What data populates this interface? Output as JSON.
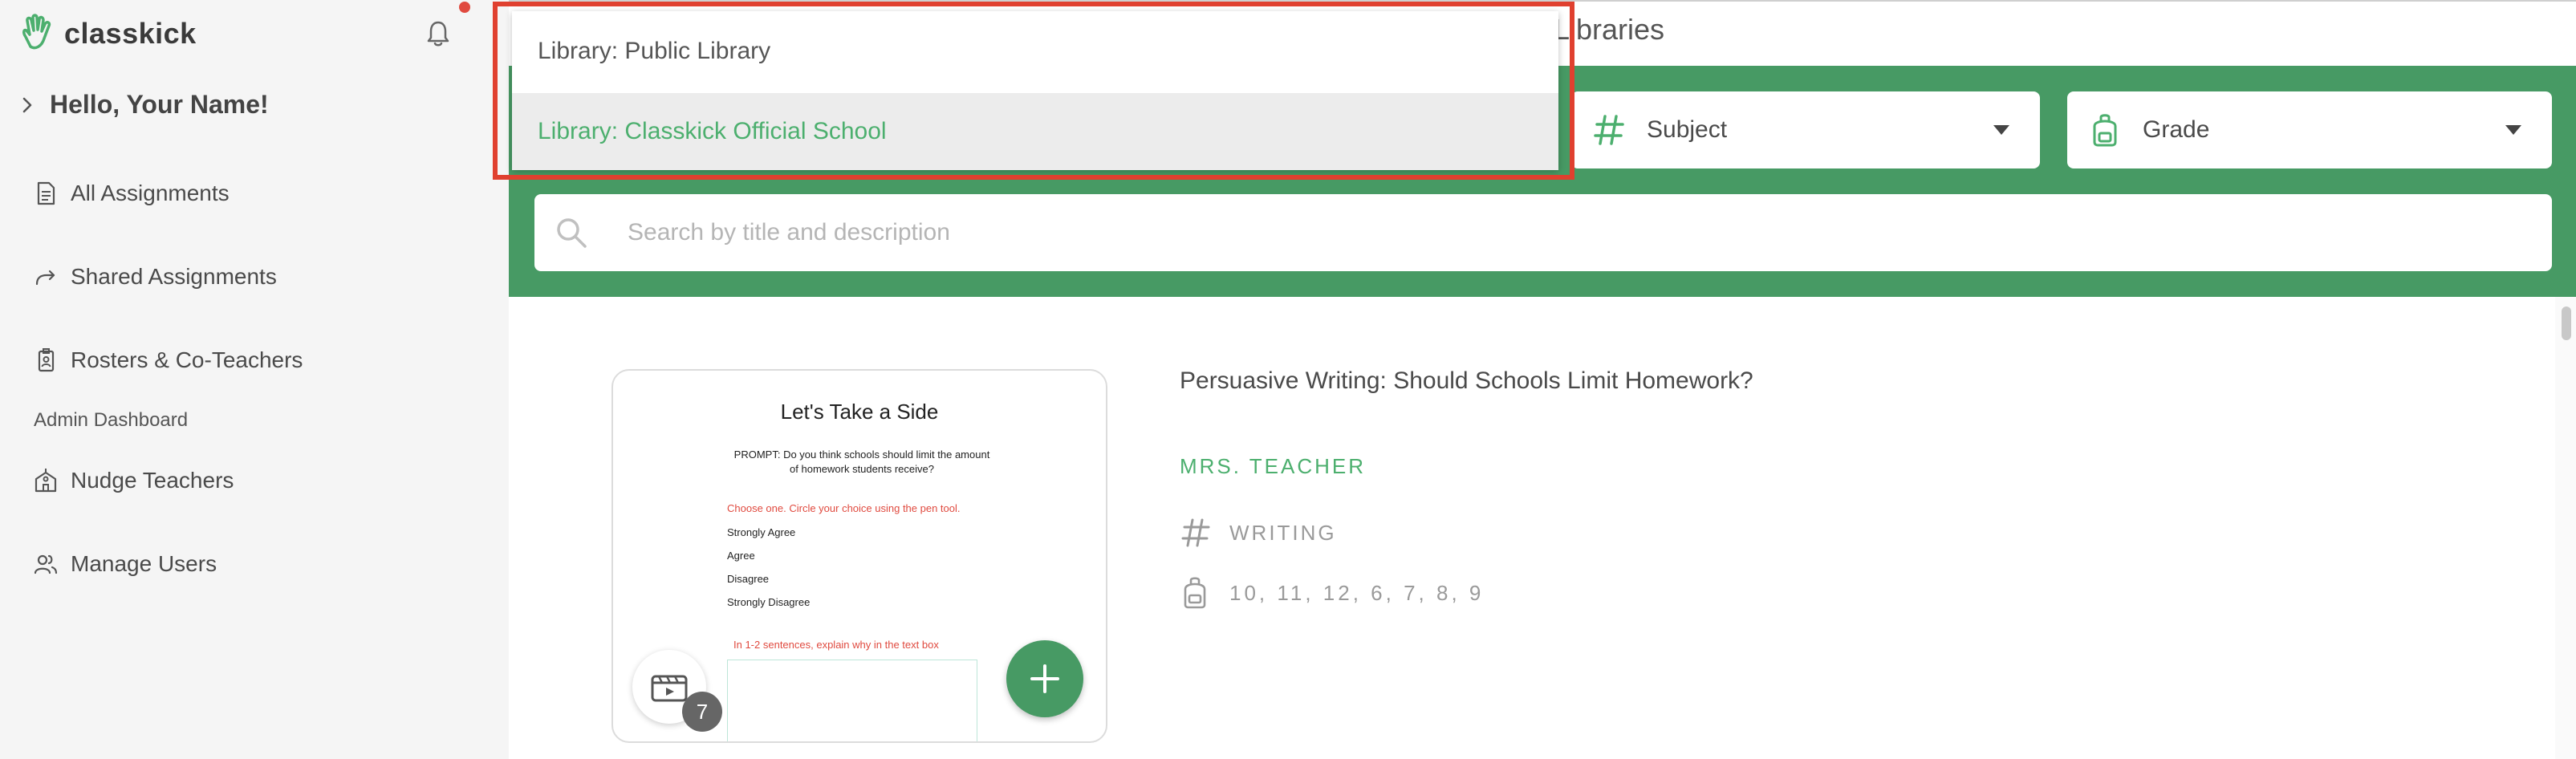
{
  "brand": {
    "name": "classkick",
    "green": "#479a64",
    "accent_green": "#4caf6e",
    "alert_red": "#e04a3f"
  },
  "sidebar": {
    "greeting": "Hello, Your Name!",
    "items": [
      {
        "label": "All Assignments",
        "icon": "document-icon"
      },
      {
        "label": "Shared Assignments",
        "icon": "share-arrow-icon"
      },
      {
        "label": "Rosters & Co-Teachers",
        "icon": "id-badge-icon"
      }
    ],
    "section_label": "Admin Dashboard",
    "admin_items": [
      {
        "label": "Nudge Teachers",
        "icon": "school-icon"
      },
      {
        "label": "Manage Users",
        "icon": "users-icon"
      }
    ]
  },
  "header": {
    "title_fragment": "Libraries"
  },
  "filters": {
    "library_options": [
      "Library: Public Library",
      "Library: Classkick Official School"
    ],
    "library_selected_index": 1,
    "subject_label": "Subject",
    "grade_label": "Grade"
  },
  "search": {
    "placeholder": "Search by title and description"
  },
  "assignment": {
    "title": "Persuasive Writing: Should Schools Limit Homework?",
    "author": "MRS. TEACHER",
    "subject": "WRITING",
    "grades": "10, 11, 12, 6, 7, 8, 9",
    "card": {
      "heading": "Let's Take a Side",
      "prompt": "PROMPT: Do you think schools should limit the amount of homework students receive?",
      "instruction": "Choose one. Circle your choice using the pen tool.",
      "choices": [
        "Strongly Agree",
        "Agree",
        "Disagree",
        "Strongly Disagree"
      ],
      "explain": "In 1-2 sentences, explain why in the text box"
    },
    "video_count": "7"
  }
}
